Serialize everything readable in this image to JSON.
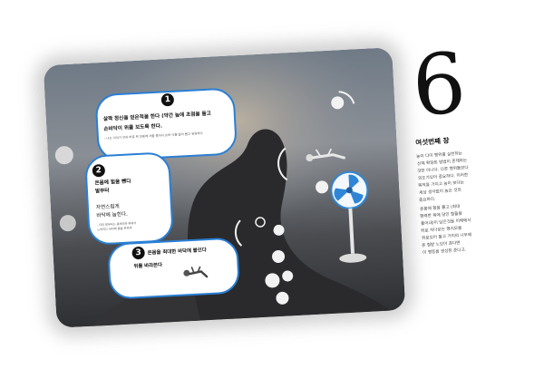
{
  "page": {
    "chapter_number": "6",
    "chapter_title": "여섯번째 장",
    "side_text_lines": [
      "높이 다이 행위를 실천하는",
      "신체 확장된 방법이 존재하는",
      "것만 아니다. 다른 행위들보다",
      "의도가있어 중요하다. 이러한",
      "목적을 가지고 높이 보다는",
      "세상 생각없이 높은 것의",
      "중요하다.",
      "온몸에 힘을 쫄고 (최대",
      "행력한 목에 닿인 힘들을",
      "풀어내)이 담은것을 이해에서",
      "위로 처다보는 행지모를",
      "위로있어 들고 거리의 나무에",
      "온 힘받 노있어 준다면",
      "이 행동을 생성된 준다고."
    ]
  },
  "bubbles": {
    "b1_number": "1",
    "b1_title": "살짝 정신을 얻은적을 한다 (약간 높에 초점을 들고",
    "b1_title2": "손바닥이 위를 보도록 한다.",
    "b1_note": "- 너는 이야기 안과 바로 위 최종에 서를 들어서 손바 닥을 잡아 뻗고 유용하다",
    "b2_number": "2",
    "b2_title": "온몸에 힘을 뺀다",
    "b2_title2": "발부터",
    "b2_sub1": "자연스럽게",
    "b2_sub2": "바닥에 눕힌다.",
    "b2_note1": "- 다리 발부터는 몸부터와 위에서",
    "b2_note2": "느껴지는 바닥에 몸을 편하게",
    "b3_number": "3",
    "b3_title": "온몸을 최대한 바닥에 붙인다",
    "b3_title2": "위를 바라본다"
  },
  "colors": {
    "bubble_border": "#2a7fd4",
    "fan_blue": "#2f86d6",
    "photo_dark": "#3a3a3c"
  },
  "icons": {
    "fan": "electric-fan-icon",
    "person_lying": "person-lying-icon",
    "person_floating": "person-floating-icon"
  }
}
